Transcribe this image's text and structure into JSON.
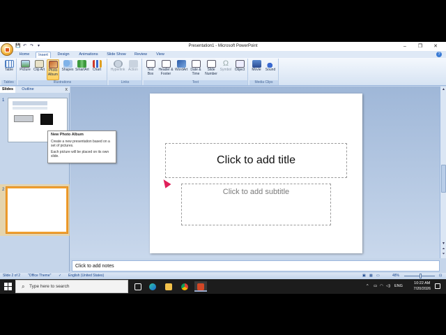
{
  "window": {
    "title": "Presentation1 - Microsoft PowerPoint",
    "controls": [
      "–",
      "❐",
      "✕"
    ]
  },
  "quick_access": [
    "💾",
    "↶",
    "↷",
    "▾"
  ],
  "tabs": [
    "Home",
    "Insert",
    "Design",
    "Animations",
    "Slide Show",
    "Review",
    "View"
  ],
  "active_tab": "Insert",
  "ribbon": {
    "tables": {
      "label": "Tables",
      "buttons": [
        "Table"
      ]
    },
    "illustrations": {
      "label": "Illustrations",
      "buttons": [
        "Picture",
        "Clip Art",
        "Photo Album",
        "Shapes",
        "SmartArt",
        "Chart"
      ]
    },
    "links": {
      "label": "Links",
      "buttons": [
        "Hyperlink",
        "Action"
      ]
    },
    "text": {
      "label": "Text",
      "buttons": [
        "Text Box",
        "Header & Footer",
        "WordArt",
        "Date & Time",
        "Slide Number",
        "Symbol",
        "Object"
      ]
    },
    "media": {
      "label": "Media Clips",
      "buttons": [
        "Movie",
        "Sound"
      ]
    }
  },
  "pane": {
    "tabs": [
      "Slides",
      "Outline"
    ],
    "close": "x",
    "slide_numbers": [
      "1",
      "2"
    ]
  },
  "tooltip": {
    "title": "New Photo Album",
    "line1": "Create a new presentation based on a set of pictures.",
    "line2": "Each picture will be placed on its own slide."
  },
  "slide": {
    "title_placeholder": "Click to add title",
    "subtitle_placeholder": "Click to add subtitle"
  },
  "notes": {
    "placeholder": "Click to add notes"
  },
  "status": {
    "slide": "Slide 2 of 2",
    "theme": "\"Office Theme\"",
    "language": "English (United States)",
    "zoom": "48%"
  },
  "taskbar": {
    "search_placeholder": "Type here to search",
    "lang": "ENG",
    "time": "10:22 AM",
    "date": "7/20/2026"
  },
  "colors": {
    "accent": "#15428b",
    "selection": "#f0a030",
    "cursor": "#e0205a"
  }
}
